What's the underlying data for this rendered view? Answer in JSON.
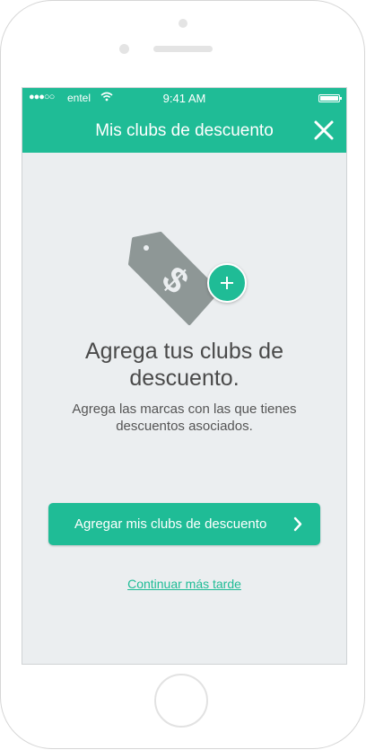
{
  "status_bar": {
    "signal": "●●●○○",
    "carrier": "entel",
    "time": "9:41 AM"
  },
  "header": {
    "title": "Mis clubs de descuento"
  },
  "empty_state": {
    "heading": "Agrega tus clubs de descuento.",
    "description": "Agrega las marcas con las que tienes descuentos asociados."
  },
  "actions": {
    "primary_label": "Agregar mis clubs de descuento",
    "later_label": "Continuar más tarde"
  },
  "colors": {
    "accent": "#1fbc96",
    "background": "#ebeef0",
    "tag_gray": "#8e9796"
  }
}
